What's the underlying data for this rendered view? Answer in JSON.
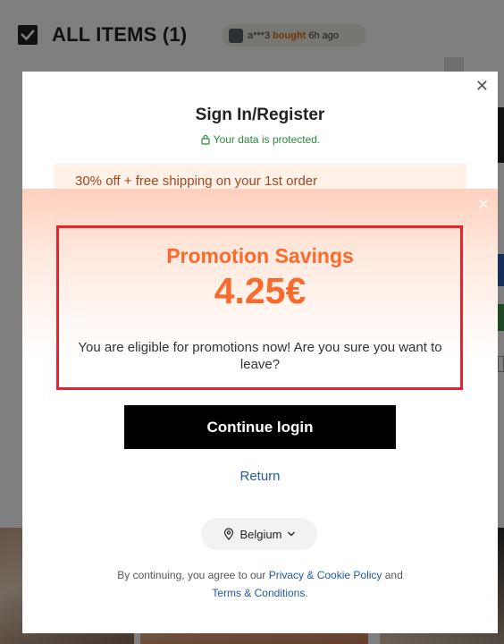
{
  "background": {
    "cart_title": "ALL ITEMS (1)",
    "social_proof": {
      "user": "a***3",
      "action": "bought",
      "time": "6h ago"
    }
  },
  "signin_dialog": {
    "title": "Sign In/Register",
    "protected_text": "Your data is protected.",
    "offer_text": "30% off + free shipping on your 1st order",
    "region": "Belgium",
    "legal": {
      "prefix": "By continuing, you agree to our ",
      "privacy_link": "Privacy & Cookie Policy",
      "and_text": " and ",
      "terms_link": "Terms & Conditions",
      "suffix": "."
    }
  },
  "promo_popup": {
    "title": "Promotion Savings",
    "amount": "4.25€",
    "message": "You are eligible for promotions now! Are you sure you want to leave?",
    "continue_label": "Continue login",
    "return_label": "Return",
    "accent_color": "#fb6a2c",
    "highlight_color": "#e8232d"
  }
}
